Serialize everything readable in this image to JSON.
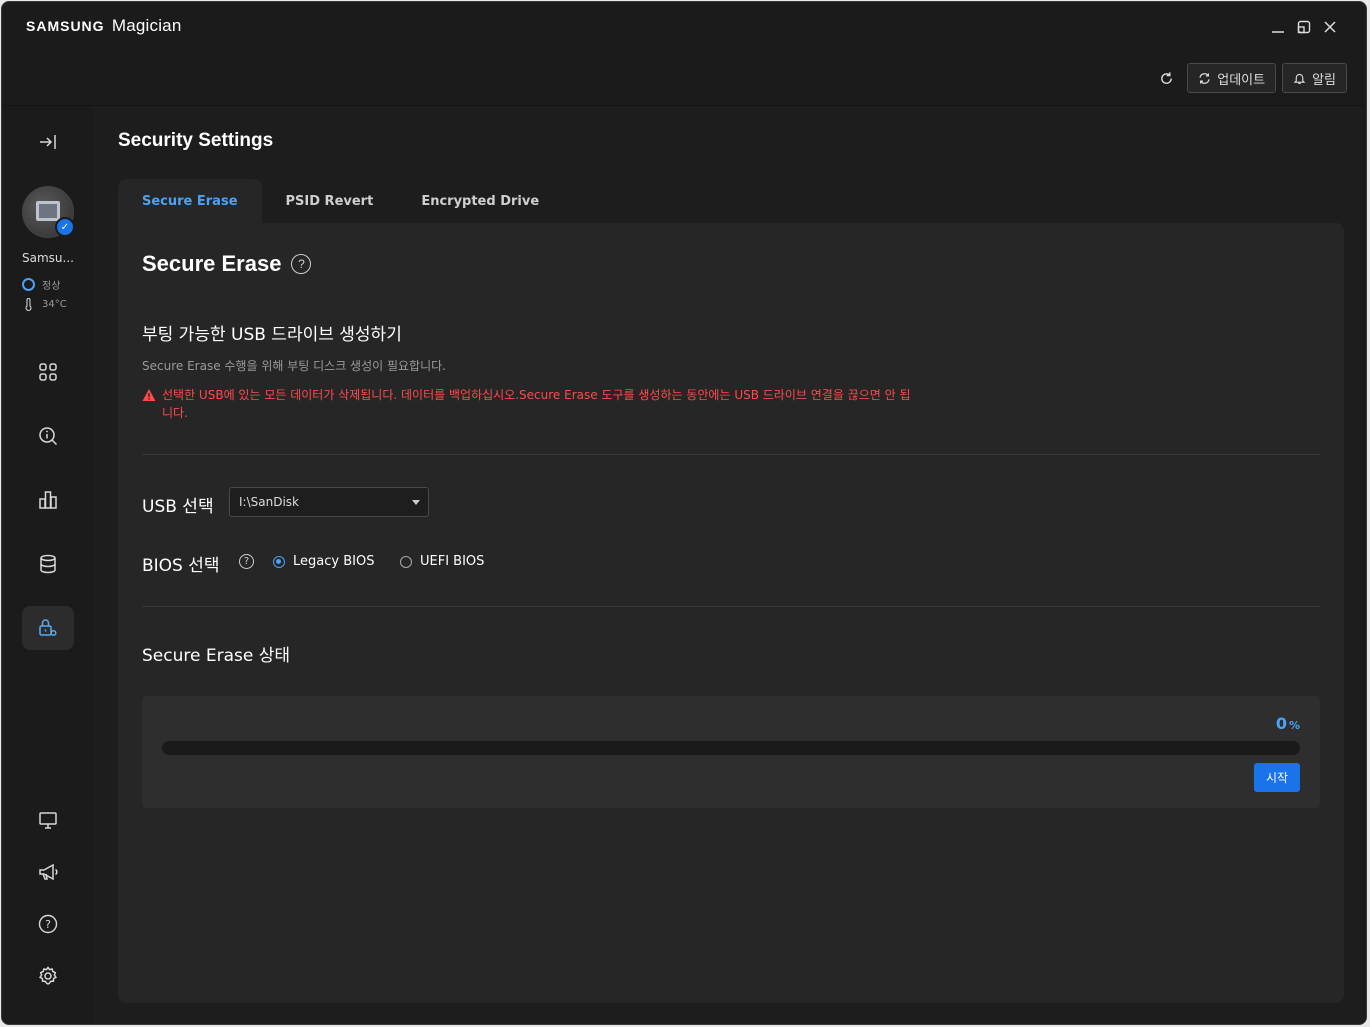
{
  "app": {
    "brand_bold": "SAMSUNG",
    "brand_name": "Magician"
  },
  "topbar": {
    "update_label": "업데이트",
    "alert_label": "알림"
  },
  "sidebar": {
    "device_name": "Samsu...",
    "health_label": "정상",
    "temperature": "34°C"
  },
  "main": {
    "page_title": "Security Settings",
    "tabs": [
      {
        "label": "Secure Erase"
      },
      {
        "label": "PSID Revert"
      },
      {
        "label": "Encrypted Drive"
      }
    ],
    "section_title": "Secure Erase",
    "sub_title": "부팅 가능한 USB 드라이브 생성하기",
    "description": "Secure Erase 수행을 위해 부팅 디스크 생성이 필요합니다.",
    "warning": "선택한 USB에 있는 모든 데이터가 삭제됩니다. 데이터를 백업하십시오.Secure Erase 도구를 생성하는 동안에는 USB 드라이브 연결을 끊으면 안 됩니다.",
    "usb_label": "USB 선택",
    "usb_selected": "I:\\SanDisk",
    "bios_label": "BIOS 선택",
    "bios_options": [
      {
        "label": "Legacy BIOS",
        "selected": true
      },
      {
        "label": "UEFI BIOS",
        "selected": false
      }
    ],
    "status_title": "Secure Erase 상태",
    "progress_value": "0",
    "progress_unit": "%",
    "progress_fraction": 0,
    "start_label": "시작"
  },
  "colors": {
    "accent": "#4aa3f7",
    "primary_button": "#1a73e8",
    "warning": "#ff4a4a",
    "background": "#1b1b1b"
  }
}
